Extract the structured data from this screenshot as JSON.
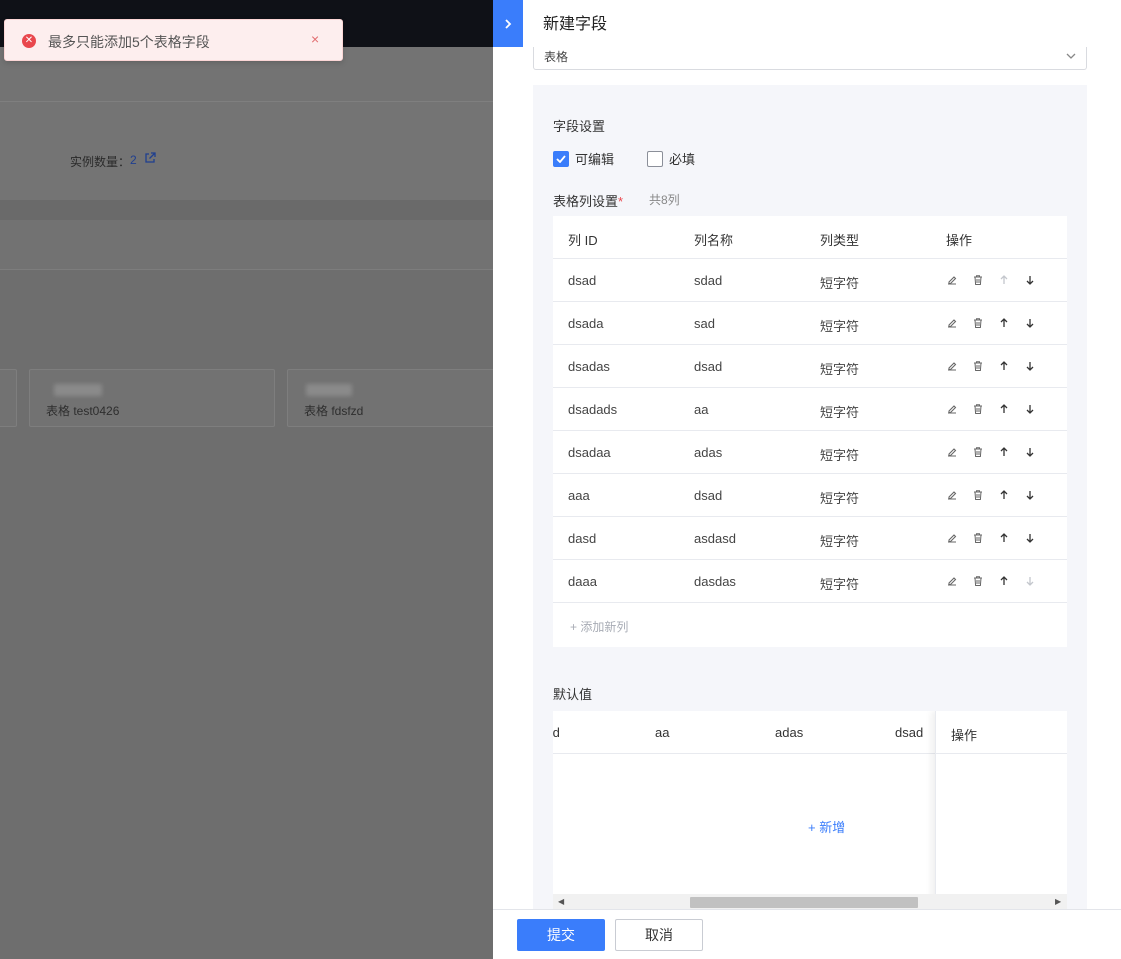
{
  "background": {
    "instance_label": "实例数量：",
    "instance_value": "2",
    "cards": [
      {
        "text": "表格  test0426"
      },
      {
        "text": "表格  fdsfzd"
      }
    ]
  },
  "toast": {
    "message": "最多只能添加5个表格字段",
    "close": "×"
  },
  "drawer": {
    "title": "新建字段",
    "field_type_value": "表格",
    "field_settings": {
      "title": "字段设置",
      "editable_label": "可编辑",
      "editable_checked": true,
      "required_label": "必填",
      "required_checked": false
    },
    "columns": {
      "title": "表格列设置",
      "required_mark": "*",
      "count_text": "共8列",
      "headers": [
        "列 ID",
        "列名称",
        "列类型",
        "操作"
      ],
      "rows": [
        {
          "id": "dsad",
          "name": "sdad",
          "type": "短字符",
          "up_enabled": false,
          "down_enabled": true
        },
        {
          "id": "dsada",
          "name": "sad",
          "type": "短字符",
          "up_enabled": true,
          "down_enabled": true
        },
        {
          "id": "dsadas",
          "name": "dsad",
          "type": "短字符",
          "up_enabled": true,
          "down_enabled": true
        },
        {
          "id": "dsadads",
          "name": "aa",
          "type": "短字符",
          "up_enabled": true,
          "down_enabled": true
        },
        {
          "id": "dsadaa",
          "name": "adas",
          "type": "短字符",
          "up_enabled": true,
          "down_enabled": true
        },
        {
          "id": "aaa",
          "name": "dsad",
          "type": "短字符",
          "up_enabled": true,
          "down_enabled": true
        },
        {
          "id": "dasd",
          "name": "asdasd",
          "type": "短字符",
          "up_enabled": true,
          "down_enabled": true
        },
        {
          "id": "daaa",
          "name": "dasdas",
          "type": "短字符",
          "up_enabled": true,
          "down_enabled": false
        }
      ],
      "add_label": "+ 添加新列"
    },
    "default_value": {
      "title": "默认值",
      "headers": [
        "ıd",
        "aa",
        "adas",
        "dsad"
      ],
      "fixed_header": "操作",
      "add_label": "+ 新增"
    },
    "footer": {
      "submit": "提交",
      "cancel": "取消"
    }
  },
  "colors": {
    "accent": "#3a7dfb",
    "error": "#e9474d",
    "toast_bg": "#fdeeee"
  }
}
